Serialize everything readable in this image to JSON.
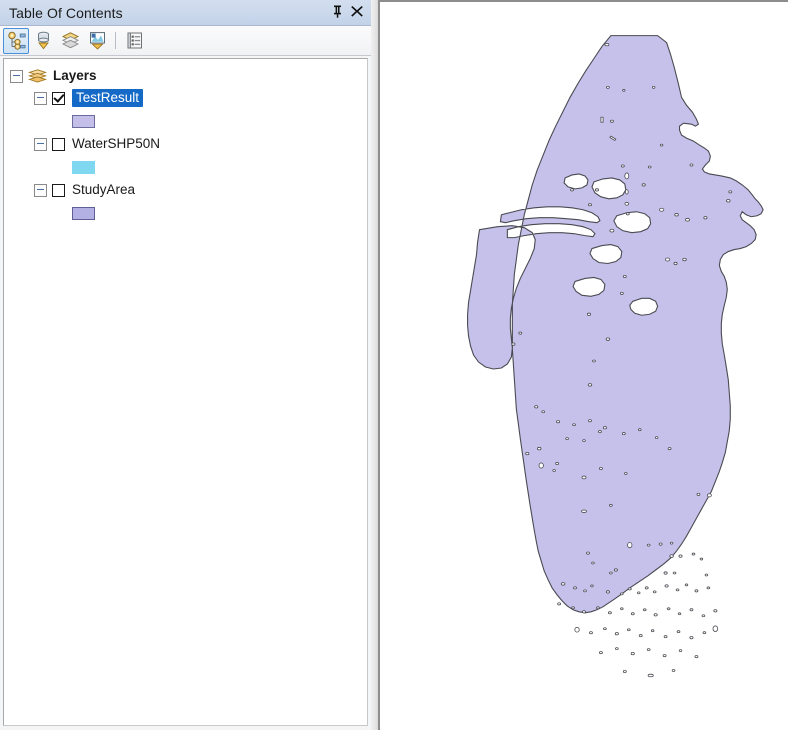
{
  "panel": {
    "title": "Table Of Contents",
    "titlebar_buttons": [
      {
        "name": "auto-hide-pin",
        "glyph": "⚊",
        "label": "Auto Hide"
      },
      {
        "name": "close",
        "glyph": "✕",
        "label": "Close"
      }
    ],
    "toolbar": [
      {
        "name": "list-by-drawing-order",
        "label": "List By Drawing Order",
        "active": true
      },
      {
        "name": "list-by-source",
        "label": "List By Source",
        "active": false
      },
      {
        "name": "list-by-visibility",
        "label": "List By Visibility",
        "active": false
      },
      {
        "name": "list-by-selection",
        "label": "List By Selection",
        "active": false
      },
      {
        "name": "options",
        "label": "Options",
        "active": false
      }
    ]
  },
  "tree": {
    "root": {
      "label": "Layers",
      "expanded": true
    },
    "layers": [
      {
        "label": "TestResult",
        "checked": true,
        "selected": true,
        "expanded": true,
        "swatch_fill": "#c3bfe8",
        "swatch_border": "#6b6b9e"
      },
      {
        "label": "WaterSHP50N",
        "checked": false,
        "selected": false,
        "expanded": true,
        "swatch_fill": "#7fd8f0",
        "swatch_border": "#7fd8f0"
      },
      {
        "label": "StudyArea",
        "checked": false,
        "selected": false,
        "expanded": true,
        "swatch_fill": "#b3b0e3",
        "swatch_border": "#5f5f96"
      }
    ]
  },
  "map": {
    "name": "data-frame",
    "background": "#ffffff",
    "polygon_fill": "#c5c1ea",
    "polygon_stroke": "#4a4a52",
    "hole_fill": "#ffffff"
  },
  "colors": {
    "titlebar_top": "#d3dff0",
    "titlebar_bottom": "#c2d2e8",
    "selection_blue": "#1569c7",
    "panel_bg": "#f4f5f7",
    "tree_bg": "#ffffff"
  }
}
